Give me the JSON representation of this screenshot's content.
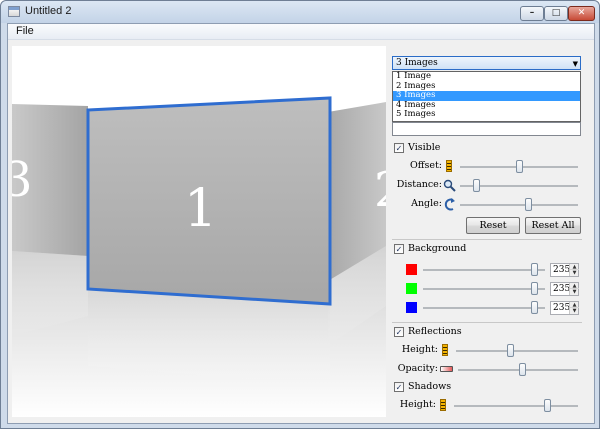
{
  "window": {
    "title": "Untitled 2",
    "minimize_glyph": "–",
    "maximize_glyph": "□",
    "close_glyph": "✕"
  },
  "menu": {
    "items": [
      "File"
    ]
  },
  "view": {
    "panels": [
      "3",
      "1",
      "2"
    ]
  },
  "images_select": {
    "value": "3 Images",
    "options": [
      "1 Image",
      "2 Images",
      "3 Images",
      "4 Images",
      "5 Images"
    ],
    "selected_index": 2
  },
  "visible": {
    "label": "Visible",
    "checked": true,
    "offset": {
      "label": "Offset:",
      "icon": "ruler-icon",
      "fraction": 0.5
    },
    "distance": {
      "label": "Distance:",
      "icon": "magnifier-icon",
      "fraction": 0.13
    },
    "angle": {
      "label": "Angle:",
      "icon": "rotate-icon",
      "fraction": 0.58
    },
    "reset_label": "Reset",
    "reset_all_label": "Reset All"
  },
  "background": {
    "label": "Background",
    "checked": true,
    "channels": [
      {
        "color": "#ff0000",
        "value": "235",
        "fraction": 0.92
      },
      {
        "color": "#00ff00",
        "value": "235",
        "fraction": 0.92
      },
      {
        "color": "#0000ff",
        "value": "235",
        "fraction": 0.92
      }
    ]
  },
  "reflections": {
    "label": "Reflections",
    "checked": true,
    "height": {
      "label": "Height:",
      "icon": "ruler-icon",
      "fraction": 0.44
    },
    "opacity": {
      "label": "Opacity:",
      "icon": "opacity-icon",
      "fraction": 0.53
    }
  },
  "shadows": {
    "label": "Shadows",
    "checked": true,
    "height": {
      "label": "Height:",
      "icon": "ruler-icon",
      "fraction": 0.75
    }
  },
  "check_glyph": "✓",
  "arrow_glyph": "▼",
  "spin_up_glyph": "▲",
  "spin_down_glyph": "▼"
}
